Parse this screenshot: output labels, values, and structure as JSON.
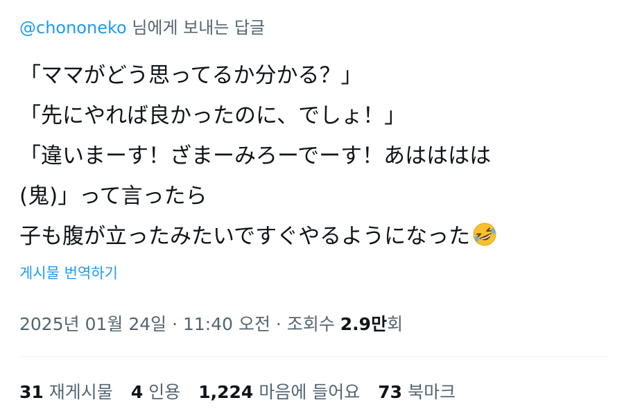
{
  "reply_context": {
    "handle": "@chononeko",
    "suffix": " 님에게 보내는 답글"
  },
  "tweet": {
    "lines": [
      "「ママがどう思ってるか分かる？」",
      "「先にやれば良かったのに、でしょ！」",
      "「違いまーす！ざまーみろーでーす！あはははは",
      "(鬼)」って言ったら",
      "子も腹が立ったみたいですぐやるようになった"
    ],
    "trailing_emoji": "rolling-on-the-floor-laughing-icon"
  },
  "translate_label": "게시물 번역하기",
  "meta": {
    "date": "2025년 01월 24일",
    "separator": " · ",
    "time": "11:40 오전",
    "views_label": "조회수 ",
    "views_count": "2.9만",
    "views_suffix": "회"
  },
  "stats": {
    "reposts_count": "31",
    "reposts_label": "재게시물",
    "quotes_count": "4",
    "quotes_label": "인용",
    "likes_count": "1,224",
    "likes_label": "마음에 들어요",
    "bookmarks_count": "73",
    "bookmarks_label": "북마크"
  },
  "colors": {
    "link_blue": "#1d9bf0",
    "secondary_text": "#536471",
    "primary_text": "#0f1419",
    "divider": "#eff3f4",
    "emoji_yellow": "#f7c12e"
  }
}
